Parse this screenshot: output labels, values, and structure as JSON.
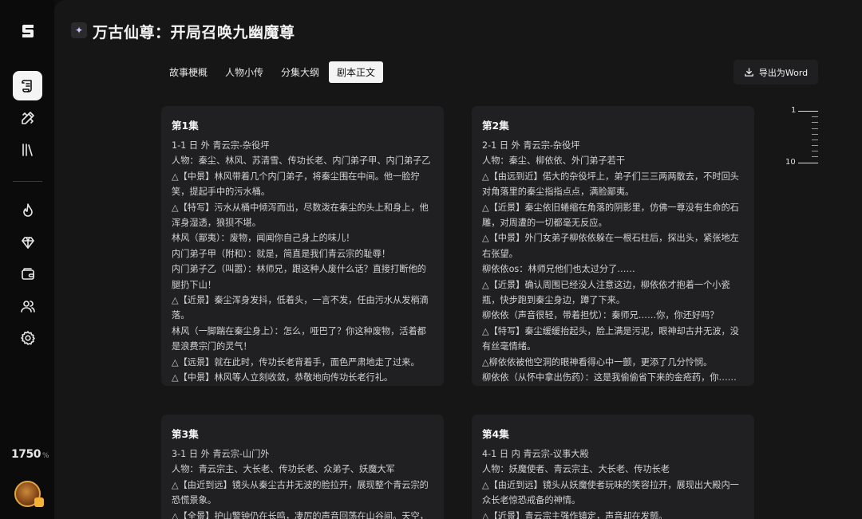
{
  "app": {
    "logo": "S",
    "credits": "1750",
    "credits_unit": "%"
  },
  "sidebar": {
    "items": [
      {
        "name": "script-icon",
        "active": true
      },
      {
        "name": "pencil-ruler-icon",
        "active": false
      },
      {
        "name": "library-icon",
        "active": false
      },
      {
        "name": "flame-icon",
        "active": false
      },
      {
        "name": "diamond-icon",
        "active": false
      },
      {
        "name": "wallet-icon",
        "active": false
      },
      {
        "name": "users-icon",
        "active": false
      },
      {
        "name": "gear-icon",
        "active": false
      }
    ]
  },
  "header": {
    "title": "万古仙尊：开局召唤九幽魔尊"
  },
  "tabs": [
    {
      "label": "故事梗概",
      "active": false
    },
    {
      "label": "人物小传",
      "active": false
    },
    {
      "label": "分集大纲",
      "active": false
    },
    {
      "label": "剧本正文",
      "active": true
    }
  ],
  "export_button": "导出为Word",
  "scale": {
    "top": "1",
    "bottom": "10"
  },
  "episodes": [
    {
      "title": "第1集",
      "lines": [
        "1-1 日 外 青云宗-杂役坪",
        "人物：秦尘、林风、苏清雪、传功长老、内门弟子甲、内门弟子乙",
        "△【中景】林风带着几个内门弟子，将秦尘围在中间。他一脸狞笑，提起手中的污水桶。",
        "△【特写】污水从桶中倾泻而出，尽数泼在秦尘的头上和身上，他浑身湿透，狼狈不堪。",
        "林风（鄙夷）：废物，闻闻你自己身上的味儿！",
        "内门弟子甲（附和）：就是，简直是我们青云宗的耻辱！",
        "内门弟子乙（叫嚣）：林师兄，跟这种人废什么话？直接打断他的腿扔下山！",
        "△【近景】秦尘浑身发抖，低着头，一言不发，任由污水从发梢滴落。",
        "林风（一脚踹在秦尘身上）：怎么，哑巴了？你这种废物，活着都是浪费宗门的灵气！",
        "△【远景】就在此时，传功长老背着手，面色严肃地走了过来。",
        "△【中景】林风等人立刻收敛，恭敬地向传功长老行礼。"
      ]
    },
    {
      "title": "第2集",
      "lines": [
        "2-1 日 外 青云宗-杂役坪",
        "人物：秦尘、柳依依、外门弟子若干",
        "△【由远到近】偌大的杂役坪上，弟子们三三两两散去，不时回头对角落里的秦尘指指点点，满脸鄙夷。",
        "△【近景】秦尘依旧蜷缩在角落的阴影里，仿佛一尊没有生命的石雕，对周遭的一切都毫无反应。",
        "△【中景】外门女弟子柳依依躲在一根石柱后，探出头，紧张地左右张望。",
        "柳依依os：林师兄他们也太过分了……",
        "△【近景】确认周围已经没人注意这边，柳依依才抱着一个小瓷瓶，快步跑到秦尘身边，蹲了下来。",
        "柳依依（声音很轻，带着担忧）：秦师兄……你，你还好吗？",
        "△【特写】秦尘缓缓抬起头，脸上满是污泥，眼神却古井无波，没有丝毫情绪。",
        "△柳依依被他空洞的眼神看得心中一颤，更添了几分怜悯。",
        "柳依依（从怀中拿出伤药）：这是我偷偷省下来的金疮药，你……"
      ]
    },
    {
      "title": "第3集",
      "lines": [
        "3-1 日 外 青云宗-山门外",
        "人物：青云宗主、大长老、传功长老、众弟子、妖魔大军",
        "△【由近到远】镜头从秦尘古井无波的脸拉开，展现整个青云宗的恐慌景象。",
        "△【全景】护山警钟仍在长鸣，凄厉的声音回荡在山谷间。天空，"
      ]
    },
    {
      "title": "第4集",
      "lines": [
        "4-1 日 内 青云宗-议事大殿",
        "人物：妖魔使者、青云宗主、大长老、传功长老",
        "△【由近到远】镜头从妖魔使者玩味的笑容拉开，展现出大殿内一众长老惊恐戒备的神情。",
        "△【近景】青云宗主强作镇定，声音却在发颤。"
      ]
    }
  ]
}
